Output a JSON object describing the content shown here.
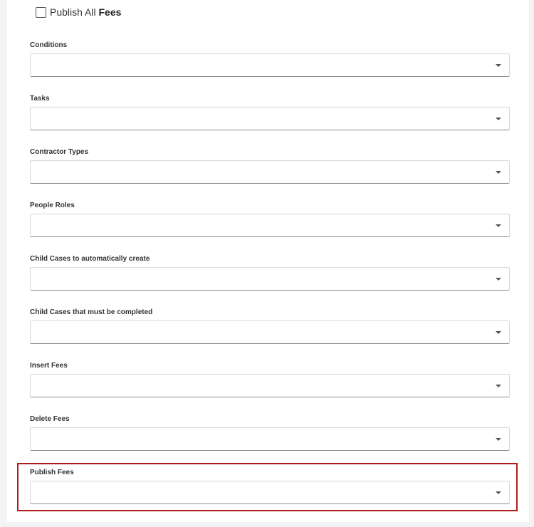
{
  "publish_all": {
    "prefix": "Publish All",
    "bold": "Fees",
    "checked": false
  },
  "fields": [
    {
      "label": "Conditions",
      "value": ""
    },
    {
      "label": "Tasks",
      "value": ""
    },
    {
      "label": "Contractor Types",
      "value": ""
    },
    {
      "label": "People Roles",
      "value": ""
    },
    {
      "label": "Child Cases to automatically create",
      "value": ""
    },
    {
      "label": "Child Cases that must be completed",
      "value": ""
    },
    {
      "label": "Insert Fees",
      "value": ""
    },
    {
      "label": "Delete Fees",
      "value": ""
    },
    {
      "label": "Publish Fees",
      "value": ""
    }
  ],
  "colors": {
    "highlight_border": "#b01c1c",
    "background": "#f3f3f5"
  },
  "icons": {
    "dropdown": "chevron-down-icon",
    "checkbox": "checkbox-unchecked-icon"
  }
}
